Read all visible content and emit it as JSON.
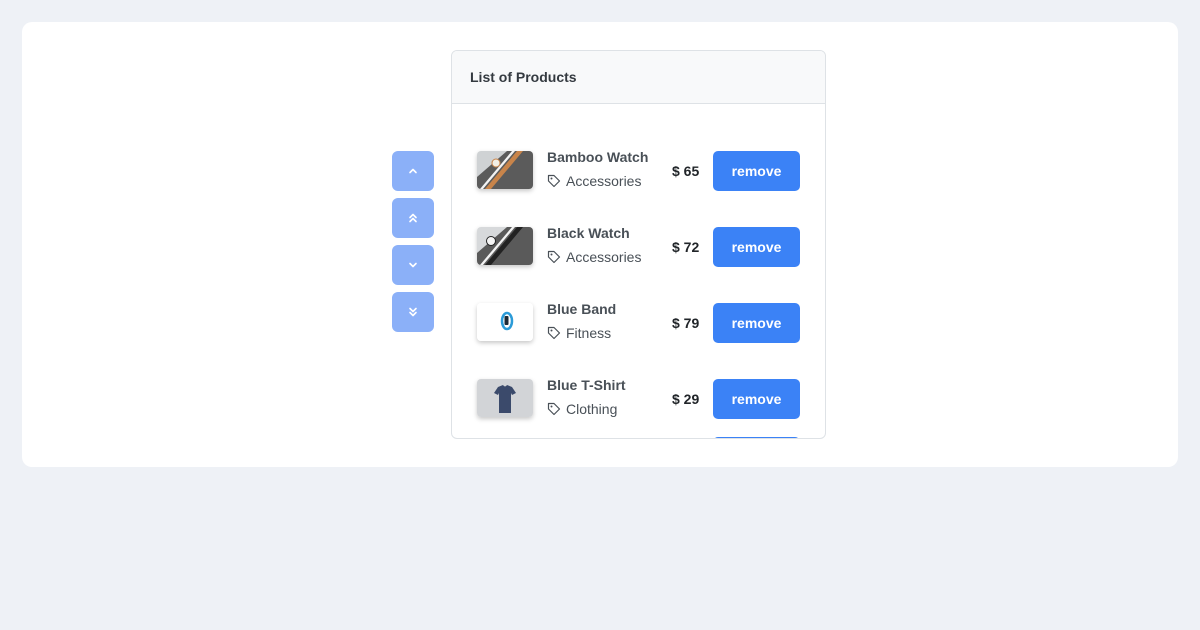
{
  "panel": {
    "title": "List of Products"
  },
  "reorder": {
    "buttons": [
      {
        "icon": "chevron-up-icon"
      },
      {
        "icon": "chevrons-up-icon"
      },
      {
        "icon": "chevron-down-icon"
      },
      {
        "icon": "chevrons-down-icon"
      }
    ]
  },
  "products": [
    {
      "name": "Bamboo Watch",
      "category": "Accessories",
      "price": "$ 65",
      "remove_label": "remove",
      "image": "bamboo-watch"
    },
    {
      "name": "Black Watch",
      "category": "Accessories",
      "price": "$ 72",
      "remove_label": "remove",
      "image": "black-watch"
    },
    {
      "name": "Blue Band",
      "category": "Fitness",
      "price": "$ 79",
      "remove_label": "remove",
      "image": "blue-band"
    },
    {
      "name": "Blue T-Shirt",
      "category": "Clothing",
      "price": "$ 29",
      "remove_label": "remove",
      "image": "blue-t-shirt"
    }
  ],
  "colors": {
    "background": "#eef1f6",
    "card": "#ffffff",
    "accent": "#3b82f6",
    "reorder_button": "#8bb0f8"
  }
}
